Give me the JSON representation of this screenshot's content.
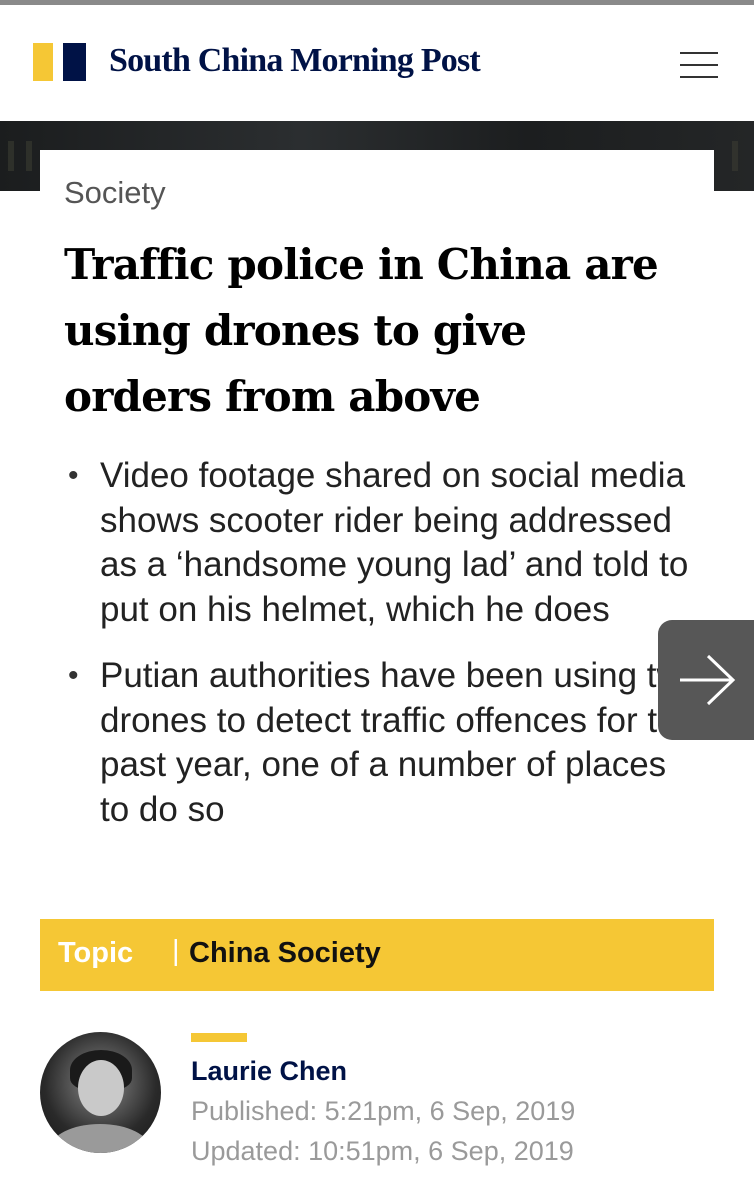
{
  "masthead": {
    "title": "South China Morning Post"
  },
  "article": {
    "section": "Society",
    "headline_lines": [
      "Traffic police in China are",
      "using drones to give",
      "orders from above"
    ],
    "bullets": [
      "Video footage shared on social media shows scooter rider being addressed as a ‘handsome young lad’ and told to put on his helmet, which he does",
      "Putian authorities have been using two drones to detect traffic offences for the past year, one of a number of places to do so"
    ]
  },
  "topic": {
    "label": "Topic",
    "separator": "|",
    "name": "China Society"
  },
  "author": {
    "name": "Laurie Chen",
    "published": "Published: 5:21pm, 6 Sep, 2019",
    "updated": "Updated: 10:51pm, 6 Sep, 2019"
  },
  "colors": {
    "brand_yellow": "#f5c735",
    "brand_navy": "#001246",
    "next_button": "#575757"
  },
  "icons": {
    "menu": "hamburger-menu-icon",
    "next": "arrow-right-icon"
  }
}
